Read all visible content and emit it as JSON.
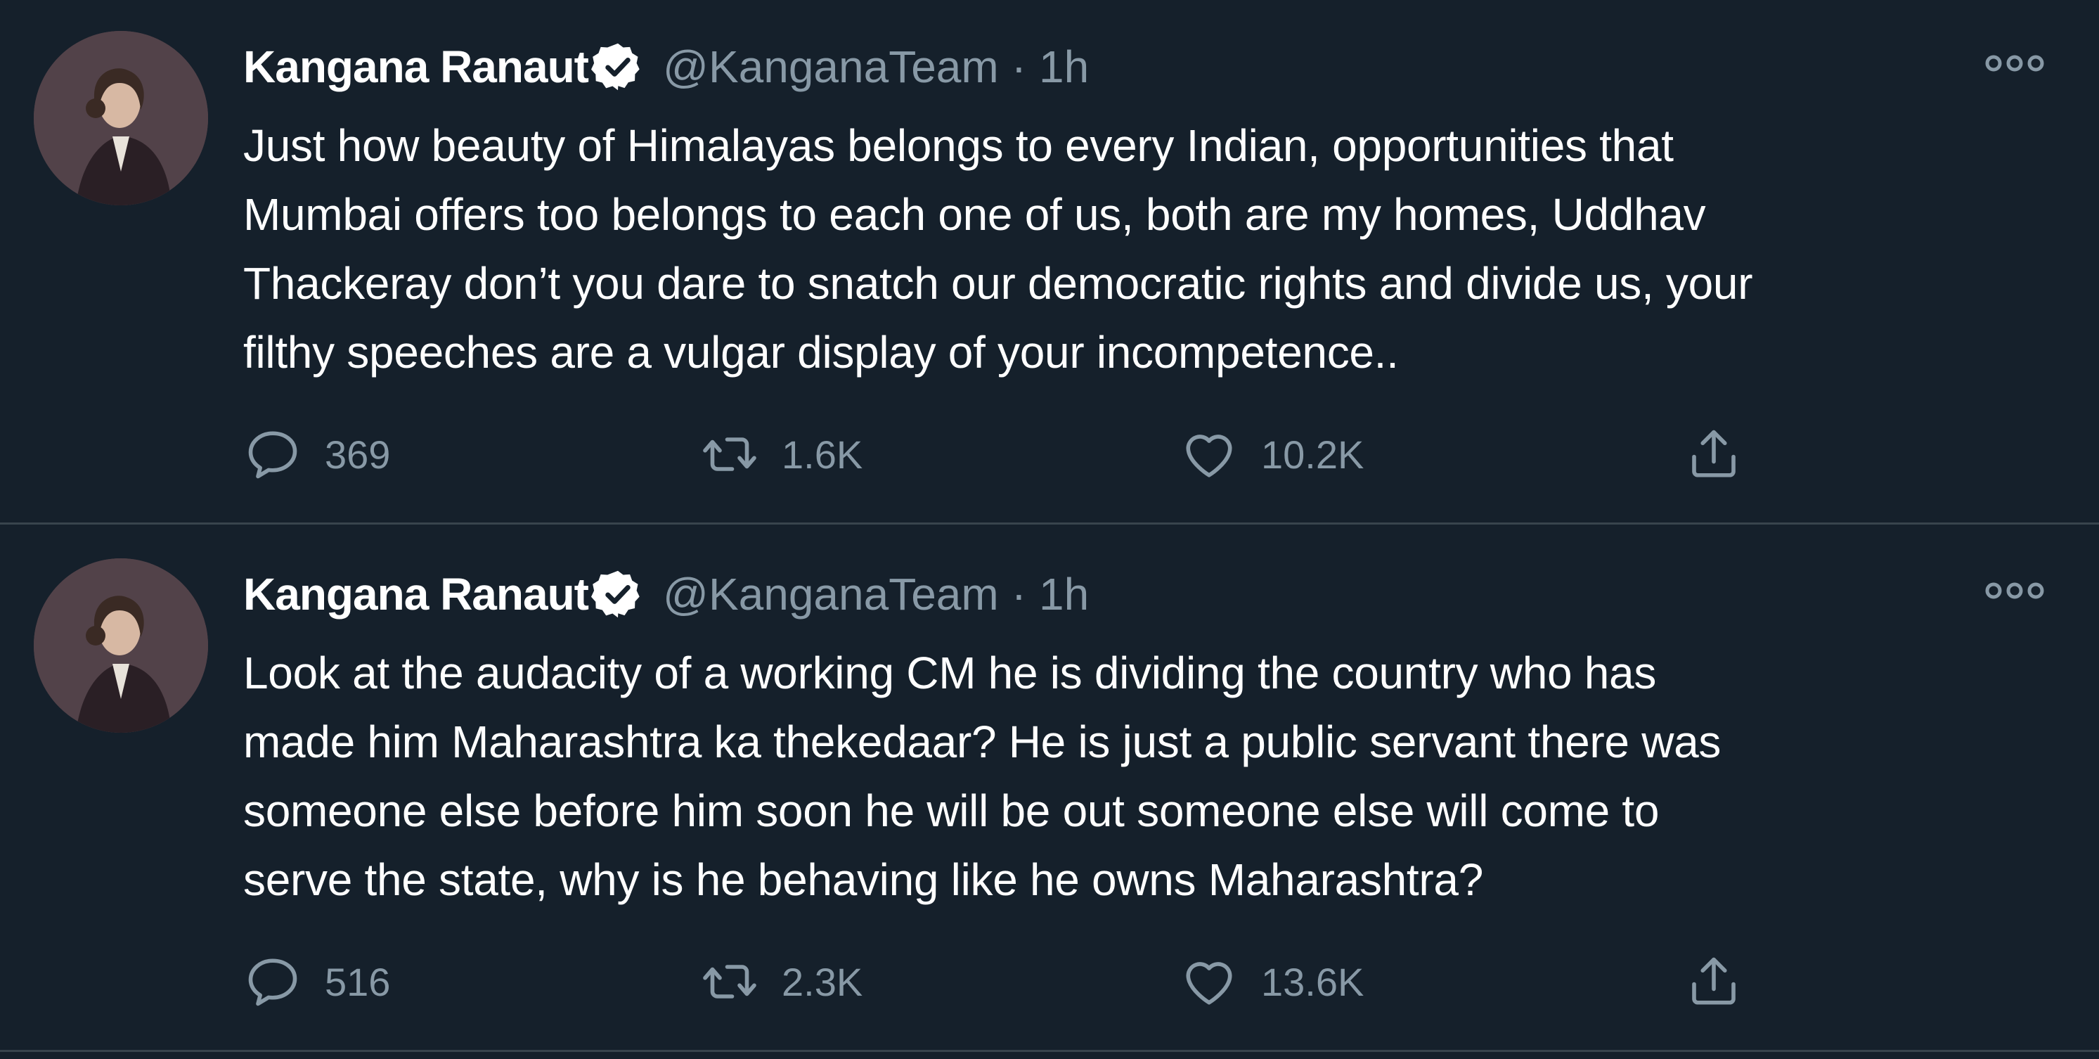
{
  "tweets": [
    {
      "display_name": "Kangana Ranaut",
      "handle": "@KanganaTeam",
      "separator": "·",
      "time": "1h",
      "text": "Just how beauty of Himalayas belongs to every Indian, opportunities that\nMumbai offers too belongs to each one of us, both are my homes, Uddhav\nThackeray don’t you dare to snatch our democratic rights and divide us, your\nfilthy speeches are a vulgar display of your incompetence..",
      "replies": "369",
      "retweets": "1.6K",
      "likes": "10.2K"
    },
    {
      "display_name": "Kangana Ranaut",
      "handle": "@KanganaTeam",
      "separator": "·",
      "time": "1h",
      "text": "Look at the audacity of a working CM he is dividing the country who has\nmade him Maharashtra ka thekedaar? He is just a public servant there was\nsomeone else before him soon he will be out someone else will come to\nserve the state, why is he behaving like he owns Maharashtra?",
      "replies": "516",
      "retweets": "2.3K",
      "likes": "13.6K"
    }
  ],
  "colors": {
    "background": "#15202b",
    "text_primary": "#ffffff",
    "text_secondary": "#8899a6",
    "divider": "#38444d"
  },
  "icons": {
    "verified": "verified-badge-icon",
    "more": "more-options-icon",
    "reply": "reply-icon",
    "retweet": "retweet-icon",
    "like": "heart-icon",
    "share": "share-icon"
  }
}
